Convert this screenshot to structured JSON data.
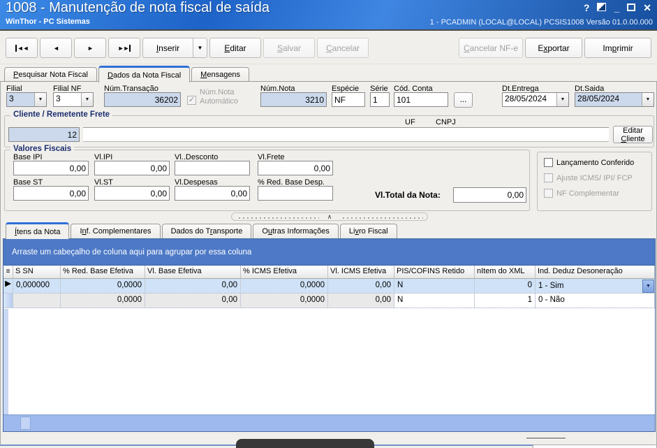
{
  "window": {
    "title": "1008 - Manutenção de nota fiscal de saída",
    "subtitle": "WinThor - PC Sistemas",
    "session": "1 - PCADMIN (LOCAL@LOCAL)  PCSIS1008  Versão 01.0.00.000",
    "controls": {
      "help": "?",
      "minimize": "_",
      "close": "✕"
    }
  },
  "icons": {
    "dropdown": "▼",
    "nav_first": "◄◄",
    "nav_prev": "◄",
    "nav_next": "►",
    "nav_last": "►►",
    "check": "✓",
    "browse": "...",
    "row_indicator": "▶",
    "header_glyph": "≡",
    "collapse_arrow": "∧"
  },
  "toolbar": {
    "inserir": "Inserir",
    "editar": "Editar",
    "salvar": "Salvar",
    "cancelar": "Cancelar",
    "cancelar_nfe": "Cancelar NF-e",
    "exportar": "Exportar",
    "imprimir": "Imprimir"
  },
  "main_tabs": [
    "Pesquisar Nota Fiscal",
    "Dados da Nota Fiscal",
    "Mensagens"
  ],
  "fields": {
    "filial": {
      "label": "Filial",
      "value": "3"
    },
    "filial_nf": {
      "label": "Filial NF",
      "value": "3"
    },
    "num_transacao": {
      "label": "Núm.Transação",
      "value": "36202"
    },
    "num_nota_auto_label": "Núm.Nota Automático",
    "num_nota": {
      "label": "Núm.Nota",
      "value": "3210"
    },
    "especie": {
      "label": "Espécie",
      "value": "NF"
    },
    "serie": {
      "label": "Série",
      "value": "1"
    },
    "cod_conta": {
      "label": "Cód. Conta",
      "value": "101"
    },
    "dt_entrega": {
      "label": "Dt.Entrega",
      "value": "28/05/2024"
    },
    "dt_saida": {
      "label": "Dt.Saida",
      "value": "28/05/2024"
    }
  },
  "cliente": {
    "group_label": "Cliente / Remetente Frete",
    "codigo": "12",
    "nome": "",
    "uf_label": "UF",
    "cnpj_label": "CNPJ",
    "editar_cliente": "Editar Cliente"
  },
  "valores": {
    "group_label": "Valores Fiscais",
    "base_ipi": {
      "label": "Base IPI",
      "value": "0,00"
    },
    "vl_ipi": {
      "label": "Vl.IPI",
      "value": "0,00"
    },
    "vl_desconto": {
      "label": "Vl..Desconto",
      "value": ""
    },
    "vl_frete": {
      "label": "Vl.Frete",
      "value": "0,00"
    },
    "base_st": {
      "label": "Base ST",
      "value": "0,00"
    },
    "vl_st": {
      "label": "Vl.ST",
      "value": "0,00"
    },
    "vl_despesas": {
      "label": "Vl.Despesas",
      "value": "0,00"
    },
    "red_base_desp": {
      "label": "% Red. Base Desp.",
      "value": ""
    },
    "vl_total": {
      "label": "Vl.Total da Nota:",
      "value": "0,00"
    }
  },
  "checks": {
    "lancamento": "Lançamento Conferido",
    "ajuste": "Ajuste ICMS/ IPI/ FCP",
    "nf_complementar": "NF Complementar"
  },
  "detail_tabs": [
    "Ítens da Nota",
    "Inf. Complementares",
    "Dados do Transporte",
    "Outras Informações",
    "Livro Fiscal"
  ],
  "grid": {
    "groupby_hint": "Arraste um cabeçalho de coluna aqui para agrupar por essa coluna",
    "columns": [
      "S SN",
      "% Red. Base Efetiva",
      "Vl. Base Efetiva",
      "% ICMS Efetiva",
      "Vl. ICMS Efetiva",
      "PIS/COFINS Retido",
      "nItem do XML",
      "Ind. Deduz Desoneração"
    ],
    "rows": [
      [
        "0,000000",
        "0,0000",
        "0,00",
        "0,0000",
        "0,00",
        "N",
        "0",
        "1 - Sim"
      ],
      [
        "",
        "0,0000",
        "0,00",
        "0,0000",
        "0,00",
        "N",
        "1",
        "0 - Não"
      ]
    ]
  }
}
